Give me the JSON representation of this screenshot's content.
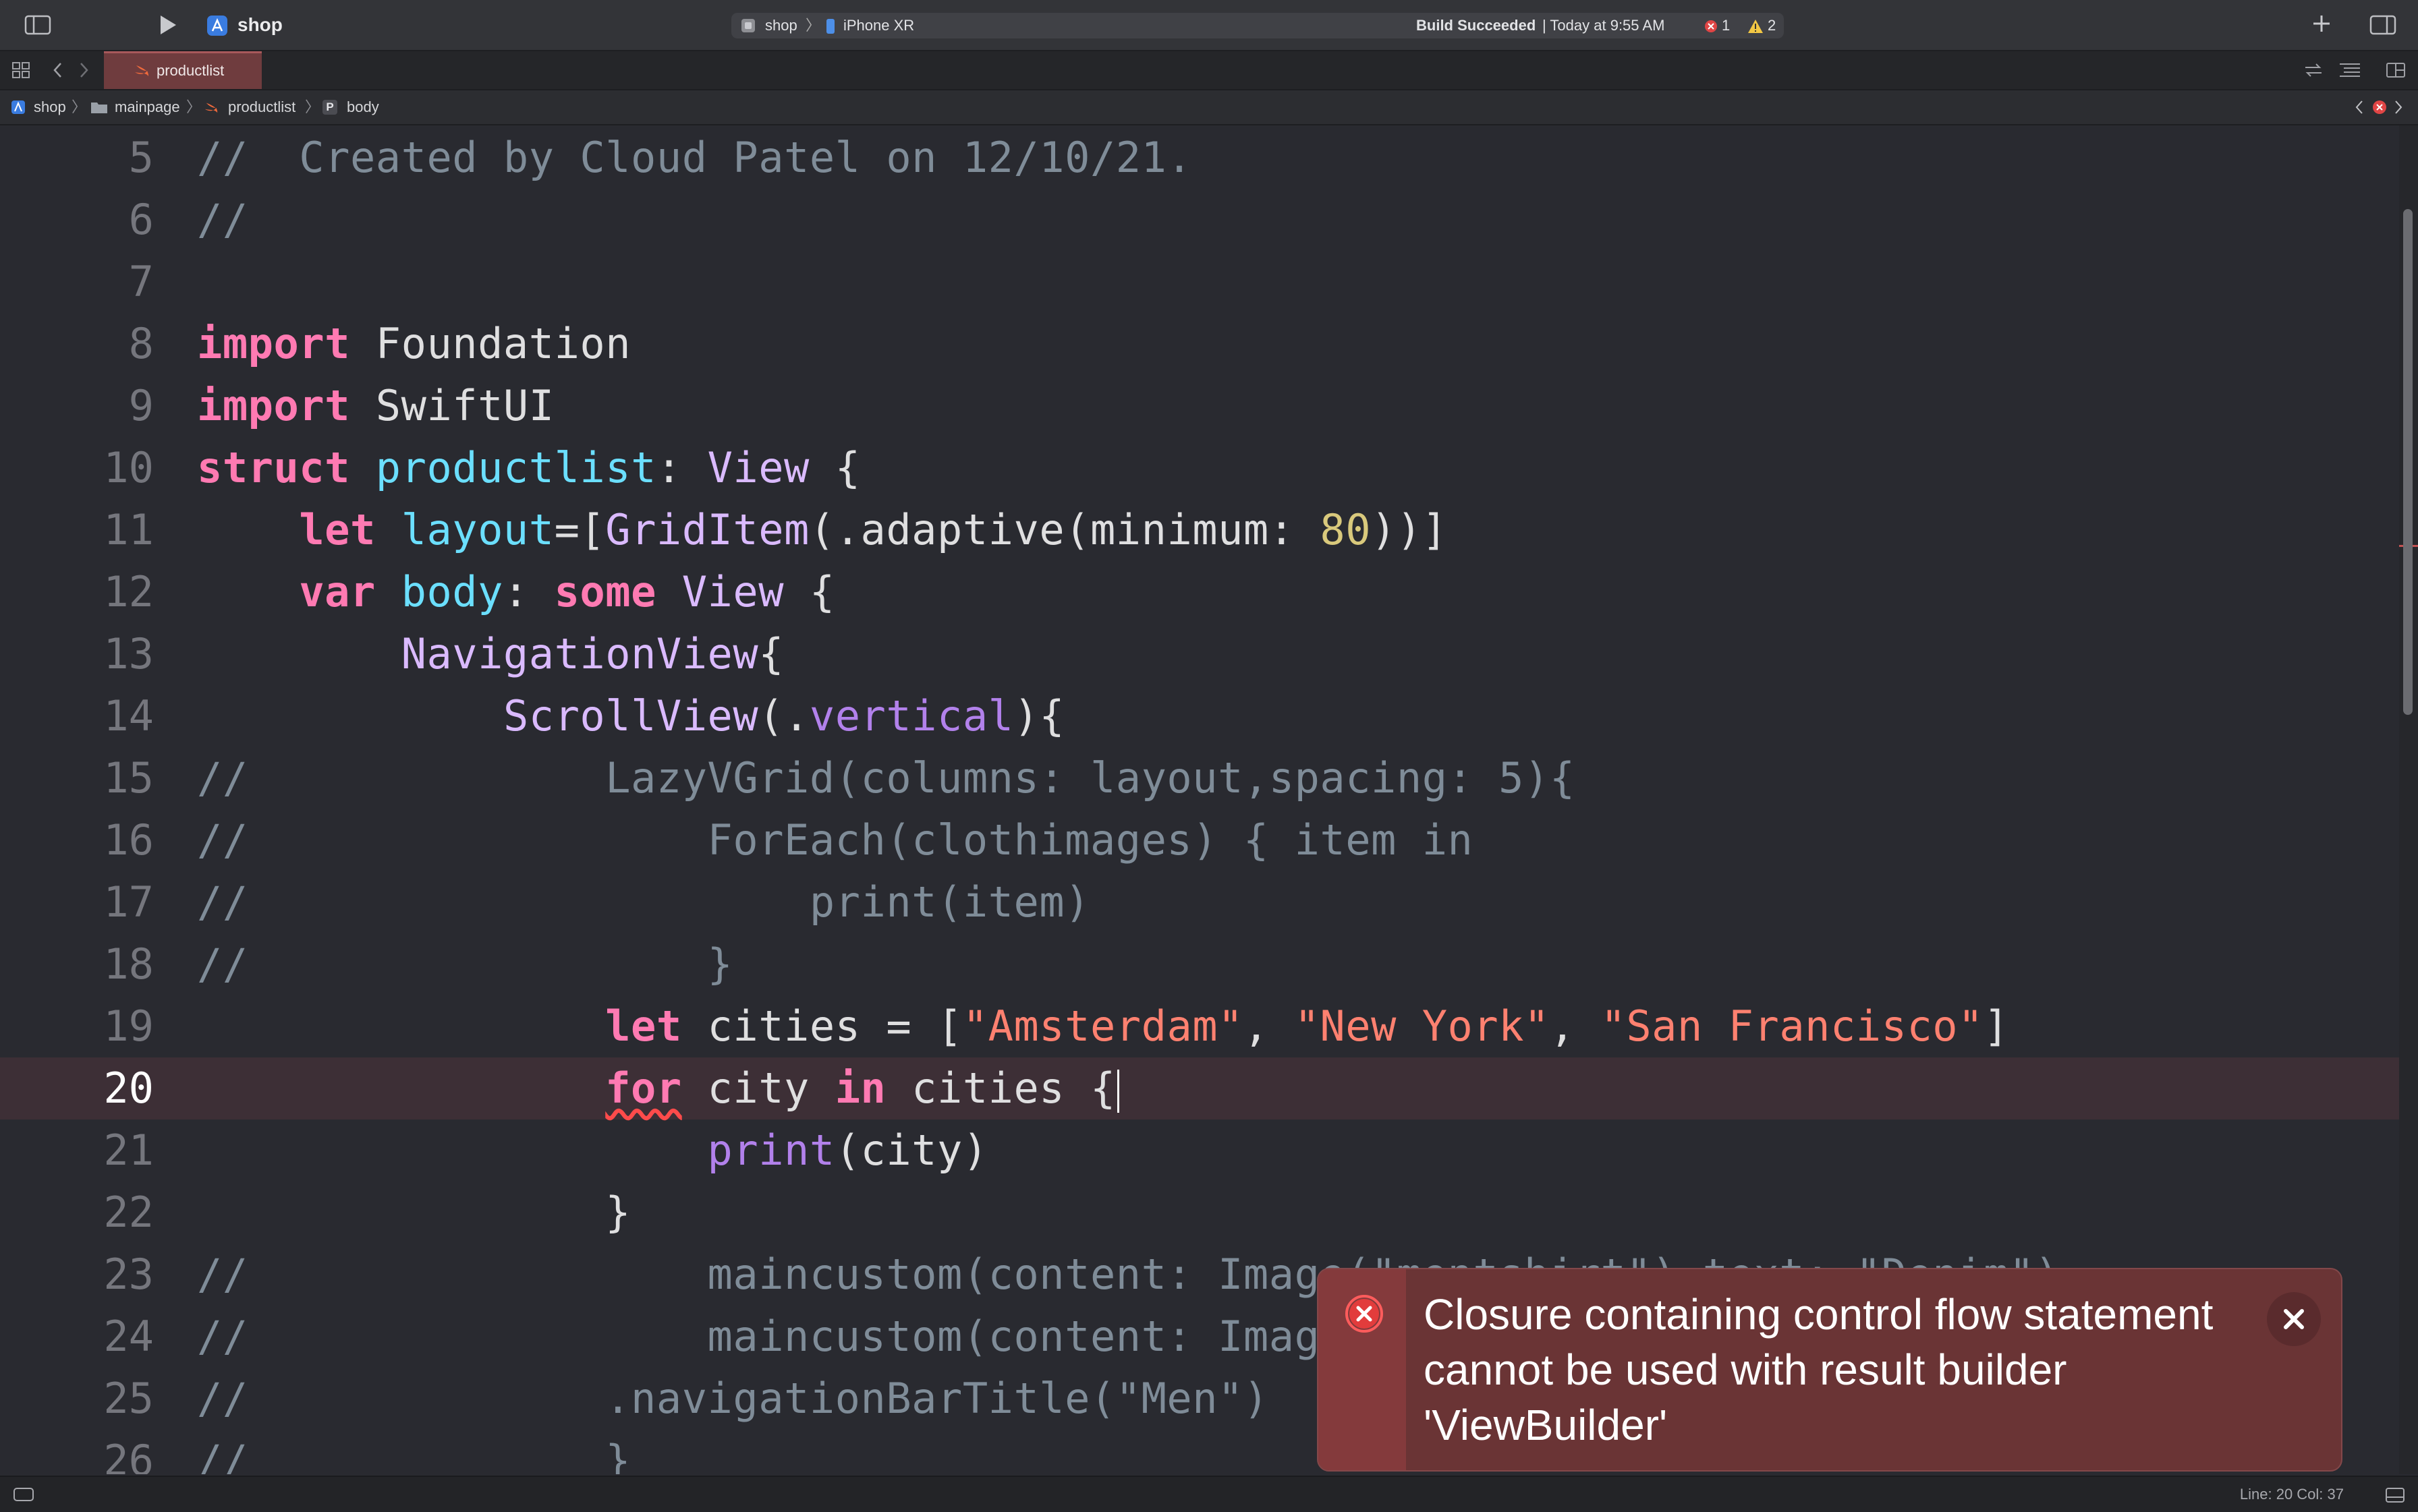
{
  "toolbar": {
    "project_name": "shop",
    "scheme": "shop",
    "scheme_separator": "〉",
    "destination": "iPhone XR",
    "build_status_strong": "Build Succeeded",
    "build_status_time": "| Today at 9:55 AM",
    "error_count": "1",
    "warning_count": "2"
  },
  "tabs": [
    {
      "label": "productlist",
      "active": true
    }
  ],
  "breadcrumb": {
    "items": [
      "shop",
      "mainpage",
      "productlist",
      "body"
    ],
    "separator": "〉"
  },
  "editor": {
    "current_line": 20,
    "lines": [
      {
        "num": "5"
      },
      {
        "num": "6"
      },
      {
        "num": "7"
      },
      {
        "num": "8"
      },
      {
        "num": "9"
      },
      {
        "num": "10"
      },
      {
        "num": "11"
      },
      {
        "num": "12"
      },
      {
        "num": "13"
      },
      {
        "num": "14"
      },
      {
        "num": "15"
      },
      {
        "num": "16"
      },
      {
        "num": "17"
      },
      {
        "num": "18"
      },
      {
        "num": "19"
      },
      {
        "num": "20"
      },
      {
        "num": "21"
      },
      {
        "num": "22"
      },
      {
        "num": "23"
      },
      {
        "num": "24"
      },
      {
        "num": "25"
      },
      {
        "num": "26"
      }
    ],
    "code": {
      "l5": "//  Created by Cloud Patel on 12/10/21.",
      "l6": "//",
      "l8_kw": "import",
      "l8_rest": " Foundation",
      "l9_kw": "import",
      "l9_rest": " SwiftUI",
      "l10_kw": "struct",
      "l10_name": "productlist",
      "l10_colon": ": ",
      "l10_type": "View",
      "l10_brace": " {",
      "l11_indent": "    ",
      "l11_kw": "let",
      "l11_name": "layout",
      "l11_eq": "=[",
      "l11_type": "GridItem",
      "l11_mid": "(.adaptive(minimum: ",
      "l11_num": "80",
      "l11_end": "))]",
      "l12_indent": "    ",
      "l12_kw": "var",
      "l12_name": "body",
      "l12_colon": ": ",
      "l12_kw2": "some",
      "l12_type": "View",
      "l12_brace": " {",
      "l13_indent": "        ",
      "l13_type": "NavigationView",
      "l13_brace": "{",
      "l14_indent": "            ",
      "l14_type": "ScrollView",
      "l14_paren": "(.",
      "l14_member": "vertical",
      "l14_end": "){",
      "l15": "//              LazyVGrid(columns: layout,spacing: 5){",
      "l16": "//                  ForEach(clothimages) { item in",
      "l17": "//                      print(item)",
      "l18": "//                  }",
      "l19_indent": "                ",
      "l19_kw": "let",
      "l19_mid": " cities = [",
      "l19_s1": "\"Amsterdam\"",
      "l19_c1": ", ",
      "l19_s2": "\"New York\"",
      "l19_c2": ", ",
      "l19_s3": "\"San Francisco\"",
      "l19_end": "]",
      "l20_indent": "                ",
      "l20_kw": "for",
      "l20_mid": " city ",
      "l20_kw2": "in",
      "l20_end": " cities {",
      "l21_indent": "                    ",
      "l21_fn": "print",
      "l21_end": "(city)",
      "l22": "                }",
      "l23": "//                  maincustom(content: Image(\"mentshirt\"),text: \"Denim\")",
      "l24": "//                  maincustom(content: Image(\"mentshirt\"),text: \"Denim\")",
      "l25": "//              .navigationBarTitle(\"Men\")",
      "l26": "//              }"
    }
  },
  "error": {
    "message": "Closure containing control flow statement cannot be used with result builder 'ViewBuilder'"
  },
  "statusbar": {
    "position": "Line: 20  Col: 37"
  },
  "colors": {
    "keyword": "#ff7ab2",
    "comment": "#7f8c98",
    "string": "#ff8170",
    "number": "#d9c97c",
    "type": "#dabaff",
    "declaration": "#6bdfff",
    "error_bg": "#6a3435"
  }
}
